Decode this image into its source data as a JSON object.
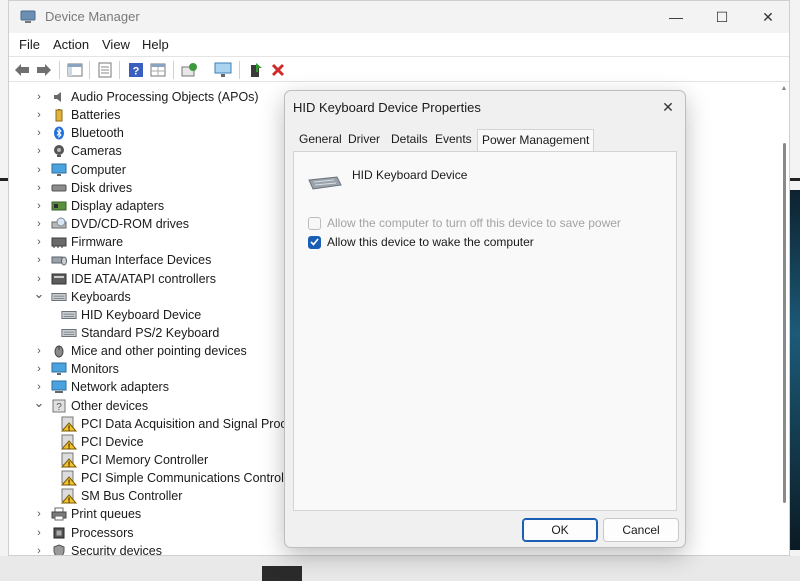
{
  "window": {
    "title": "Device Manager",
    "controls": {
      "minimize": "—",
      "maximize": "☐",
      "close": "✕"
    }
  },
  "menu": [
    "File",
    "Action",
    "View",
    "Help"
  ],
  "toolbar_icons": [
    "back-arrow-icon",
    "forward-arrow-icon",
    "show-hide-tree-icon",
    "properties-sheet-icon",
    "help-icon",
    "properties-grid-icon",
    "update-driver-icon",
    "scan-hardware-icon",
    "enable-device-icon",
    "uninstall-device-icon"
  ],
  "tree": [
    {
      "label": "Audio Processing Objects (APOs)",
      "icon": "speaker-icon",
      "expanded": false,
      "level": 0
    },
    {
      "label": "Batteries",
      "icon": "battery-icon",
      "expanded": false,
      "level": 0
    },
    {
      "label": "Bluetooth",
      "icon": "bluetooth-icon",
      "expanded": false,
      "level": 0
    },
    {
      "label": "Cameras",
      "icon": "camera-icon",
      "expanded": false,
      "level": 0
    },
    {
      "label": "Computer",
      "icon": "monitor-icon",
      "expanded": false,
      "level": 0
    },
    {
      "label": "Disk drives",
      "icon": "disk-icon",
      "expanded": false,
      "level": 0
    },
    {
      "label": "Display adapters",
      "icon": "display-adapter-icon",
      "expanded": false,
      "level": 0
    },
    {
      "label": "DVD/CD-ROM drives",
      "icon": "dvd-icon",
      "expanded": false,
      "level": 0
    },
    {
      "label": "Firmware",
      "icon": "firmware-icon",
      "expanded": false,
      "level": 0
    },
    {
      "label": "Human Interface Devices",
      "icon": "hid-icon",
      "expanded": false,
      "level": 0
    },
    {
      "label": "IDE ATA/ATAPI controllers",
      "icon": "ide-controller-icon",
      "expanded": false,
      "level": 0
    },
    {
      "label": "Keyboards",
      "icon": "keyboard-icon",
      "expanded": true,
      "level": 0
    },
    {
      "label": "HID Keyboard Device",
      "icon": "keyboard-icon",
      "level": 1
    },
    {
      "label": "Standard PS/2 Keyboard",
      "icon": "keyboard-icon",
      "level": 1
    },
    {
      "label": "Mice and other pointing devices",
      "icon": "mouse-icon",
      "expanded": false,
      "level": 0
    },
    {
      "label": "Monitors",
      "icon": "monitor-icon",
      "expanded": false,
      "level": 0
    },
    {
      "label": "Network adapters",
      "icon": "network-icon",
      "expanded": false,
      "level": 0
    },
    {
      "label": "Other devices",
      "icon": "unknown-device-icon",
      "expanded": true,
      "level": 0
    },
    {
      "label": "PCI Data Acquisition and Signal Proce",
      "icon": "warning-device-icon",
      "level": 1
    },
    {
      "label": "PCI Device",
      "icon": "warning-device-icon",
      "level": 1
    },
    {
      "label": "PCI Memory Controller",
      "icon": "warning-device-icon",
      "level": 1
    },
    {
      "label": "PCI Simple Communications Controlle",
      "icon": "warning-device-icon",
      "level": 1
    },
    {
      "label": "SM Bus Controller",
      "icon": "warning-device-icon",
      "level": 1
    },
    {
      "label": "Print queues",
      "icon": "printer-icon",
      "expanded": false,
      "level": 0
    },
    {
      "label": "Processors",
      "icon": "processor-icon",
      "expanded": false,
      "level": 0
    },
    {
      "label": "Security devices",
      "icon": "security-icon",
      "expanded": false,
      "level": 0
    }
  ],
  "dialog": {
    "title": "HID Keyboard Device Properties",
    "close": "✕",
    "tabs": [
      "General",
      "Driver",
      "Details",
      "Events",
      "Power Management"
    ],
    "active_tab": "Power Management",
    "device_name": "HID Keyboard Device",
    "options": [
      {
        "label": "Allow the computer to turn off this device to save power",
        "checked": false,
        "enabled": false
      },
      {
        "label": "Allow this device to wake the computer",
        "checked": true,
        "enabled": true
      }
    ],
    "ok_label": "OK",
    "cancel_label": "Cancel"
  },
  "colors": {
    "accent": "#1a5fb4",
    "disabled_text": "#a3a3a3",
    "dialog_bg": "#f0f0f0"
  }
}
